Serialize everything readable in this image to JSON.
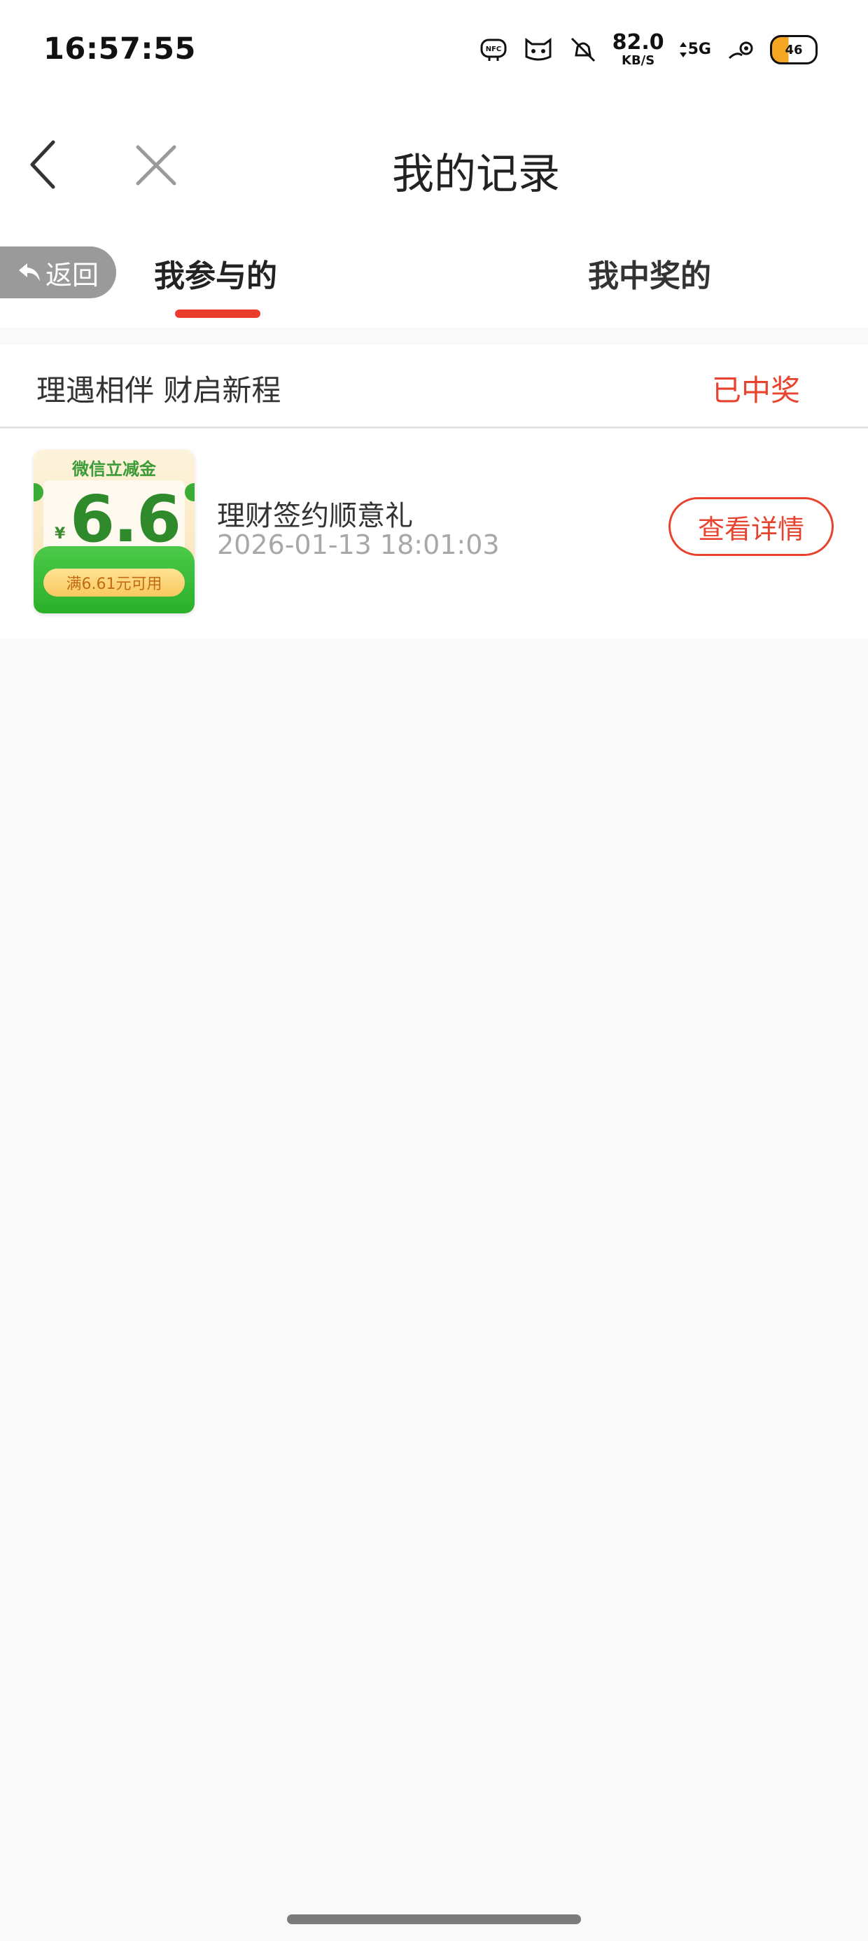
{
  "status_bar": {
    "time": "16:57:55",
    "net_speed_value": "82.0",
    "net_speed_unit": "KB/S",
    "network_type": "5G",
    "battery_level": "46",
    "icons": [
      "nfc-icon",
      "cat-mask-icon",
      "alarm-off-icon",
      "data-arrows-icon",
      "signal-icon",
      "battery-icon"
    ]
  },
  "nav": {
    "title": "我的记录"
  },
  "tabs": {
    "return_label": "返回",
    "items": [
      {
        "label": "我参与的",
        "active": true
      },
      {
        "label": "我中奖的",
        "active": false
      }
    ]
  },
  "record": {
    "name": "理遇相伴 财启新程",
    "status": "已中奖",
    "item": {
      "coupon_title": "微信立减金",
      "coupon_currency": "¥",
      "coupon_amount": "6.6",
      "coupon_condition": "满6.61元可用",
      "title": "理财签约顺意礼",
      "time": "2026-01-13 18:01:03",
      "detail_button": "查看详情"
    }
  },
  "colors": {
    "accent": "#e8432e",
    "tab_underline": "#ea3b2d",
    "coupon_green": "#2f8a2b",
    "background": "#f9f9f9"
  }
}
